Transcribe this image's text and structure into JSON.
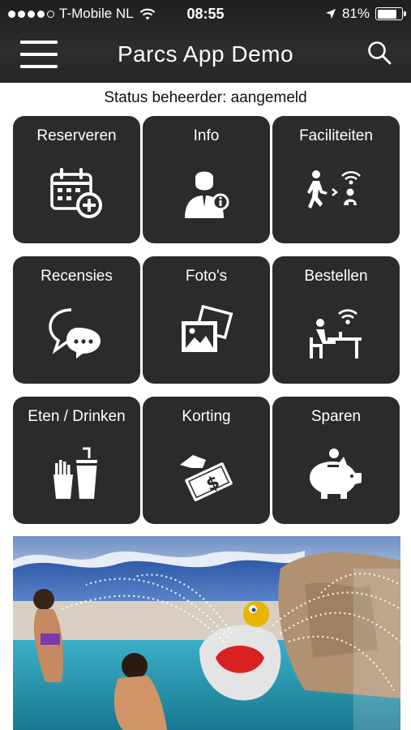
{
  "statusbar": {
    "carrier": "T-Mobile NL",
    "time": "08:55",
    "battery": "81%",
    "battery_level": 0.81,
    "signal_bars_filled": 4,
    "signal_bars_total": 5
  },
  "navbar": {
    "title": "Parcs App Demo",
    "menu_icon": "hamburger-menu-icon",
    "search_icon": "search-icon"
  },
  "status_text": "Status beheerder: aangemeld",
  "tiles": [
    {
      "label": "Reserveren",
      "icon": "calendar-add-icon"
    },
    {
      "label": "Info",
      "icon": "person-info-icon"
    },
    {
      "label": "Faciliteiten",
      "icon": "walking-wifi-icon"
    },
    {
      "label": "Recensies",
      "icon": "chat-bubbles-icon"
    },
    {
      "label": "Foto's",
      "icon": "photos-icon"
    },
    {
      "label": "Bestellen",
      "icon": "table-wifi-icon"
    },
    {
      "label": "Eten / Drinken",
      "icon": "fries-drink-icon"
    },
    {
      "label": "Korting",
      "icon": "money-hand-icon"
    },
    {
      "label": "Sparen",
      "icon": "piggy-bank-icon"
    }
  ],
  "colors": {
    "bar_background": "#262626",
    "tile_background": "#2b2b2b",
    "tile_text": "#ffffff"
  },
  "banner": {
    "icon": "pool-photo"
  }
}
